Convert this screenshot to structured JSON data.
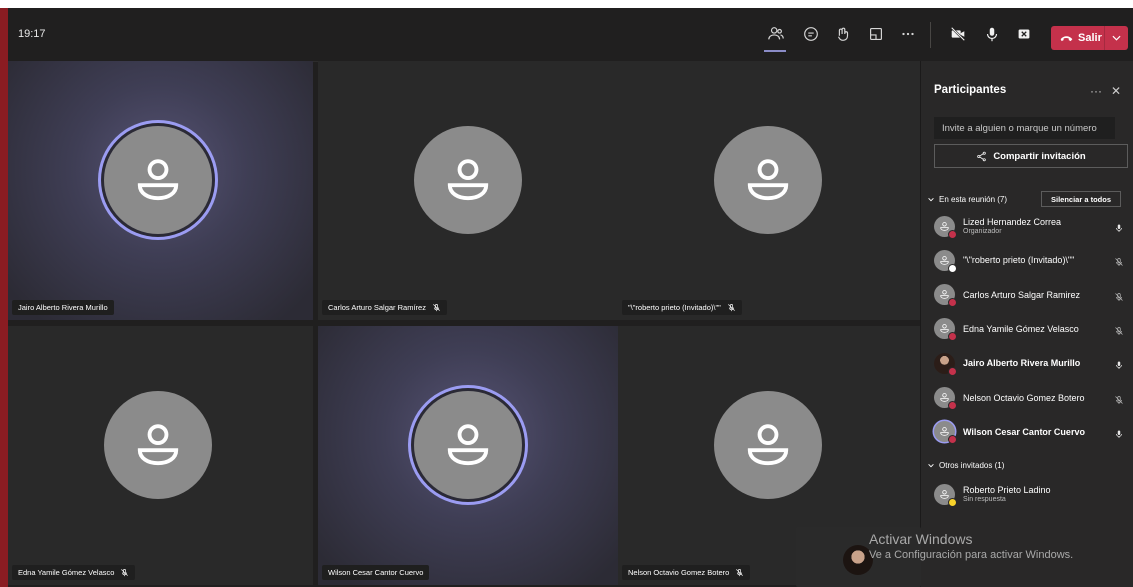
{
  "meeting": {
    "time": "19:17"
  },
  "toolbar": {
    "icons": [
      "participants-icon",
      "chat-icon",
      "reactions-icon",
      "share-tray-icon",
      "more-icon",
      "camera-off-icon",
      "mic-icon",
      "share-screen-icon"
    ],
    "leave_label": "Salir",
    "leave_color": "#c4314b",
    "active_underline_color": "#8b8cc7"
  },
  "tiles": [
    {
      "name": "Jairo Alberto Rivera Murillo",
      "speaking": true,
      "muted": false
    },
    {
      "name": "Carlos Arturo Salgar Ramírez",
      "speaking": false,
      "muted": true
    },
    {
      "name": "\"\\\"roberto prieto (Invitado)\\\"\"",
      "speaking": false,
      "muted": true
    },
    {
      "name": "Edna Yamile Gómez Velasco",
      "speaking": false,
      "muted": true
    },
    {
      "name": "Wilson Cesar Cantor Cuervo",
      "speaking": true,
      "muted": false
    },
    {
      "name": "Nelson Octavio Gomez Botero",
      "speaking": false,
      "muted": true
    }
  ],
  "panel": {
    "title": "Participantes",
    "more": "···",
    "close": "✕",
    "invite_placeholder": "Invite a alguien o marque un número",
    "share_label": "Compartir invitación",
    "in_meeting_label": "En esta reunión (7)",
    "mute_all_label": "Silenciar a todos",
    "others_label": "Otros invitados (1)",
    "in_meeting": [
      {
        "name": "Lized Hernandez Correa",
        "role": "Organizador",
        "mic": "on",
        "status": "busy",
        "bold": false
      },
      {
        "name": "\"\\\"roberto prieto (Invitado)\\\"\"",
        "role": "",
        "mic": "off",
        "status": "offline",
        "bold": false
      },
      {
        "name": "Carlos Arturo Salgar Ramirez",
        "role": "",
        "mic": "off",
        "status": "busy",
        "bold": false
      },
      {
        "name": "Edna Yamile Gómez Velasco",
        "role": "",
        "mic": "off",
        "status": "busy",
        "bold": false
      },
      {
        "name": "Jairo Alberto Rivera Murillo",
        "role": "",
        "mic": "on",
        "status": "busy",
        "bold": true,
        "photo": true
      },
      {
        "name": "Nelson Octavio Gomez Botero",
        "role": "",
        "mic": "off",
        "status": "busy",
        "bold": false
      },
      {
        "name": "Wilson Cesar Cantor Cuervo",
        "role": "",
        "mic": "on",
        "status": "busy",
        "bold": true,
        "ring": true
      }
    ],
    "others": [
      {
        "name": "Roberto Prieto Ladino",
        "role": "Sin respuesta",
        "status": "away"
      }
    ],
    "status_colors": {
      "busy": "#c4314b",
      "offline": "#ffffff",
      "away": "#f8d22a"
    }
  },
  "watermark": {
    "line1": "Activar Windows",
    "line2": "Ve a Configuración para activar Windows."
  }
}
